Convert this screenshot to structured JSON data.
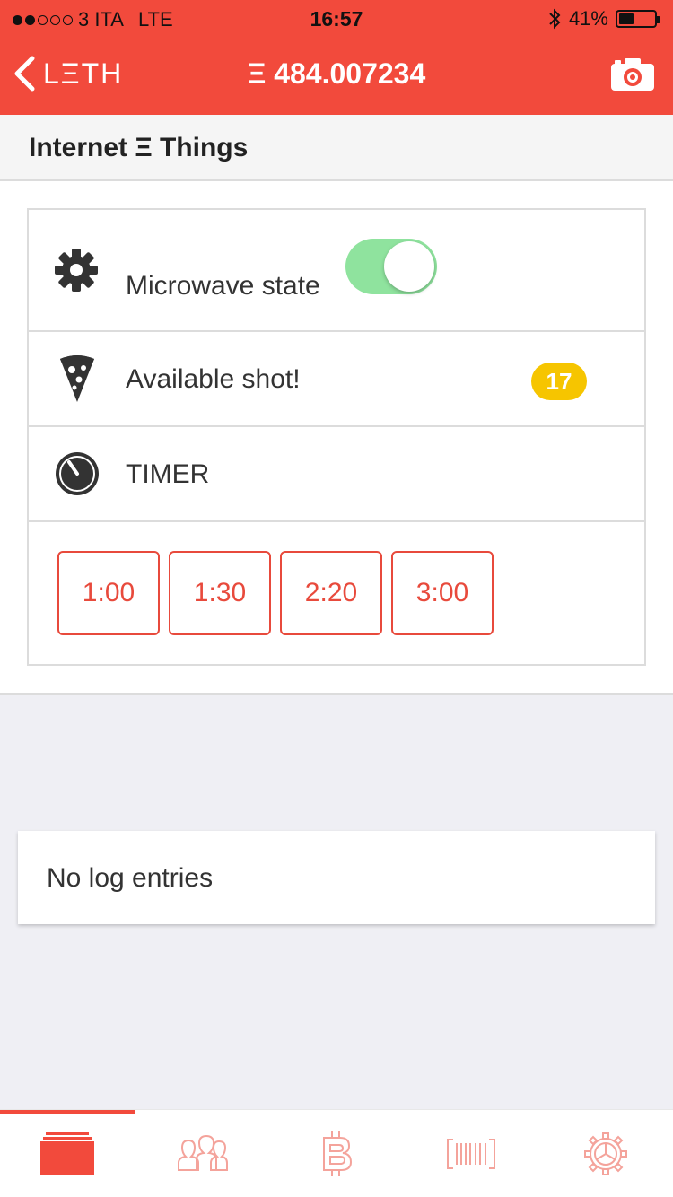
{
  "status_bar": {
    "carrier": "3 ITA",
    "network": "LTE",
    "time": "16:57",
    "battery": "41%",
    "battery_level": 0.41,
    "signal_bars_filled": 2,
    "signal_bars_total": 5
  },
  "nav": {
    "back_label": "LΞTH",
    "title": "Ξ 484.007234",
    "back_icon": "chevron-left-icon",
    "camera_icon": "camera-icon"
  },
  "section": {
    "title": "Internet Ξ Things"
  },
  "rows": {
    "microwave": {
      "label": "Microwave state",
      "icon": "gear-icon",
      "toggle_on": true
    },
    "shot": {
      "label": "Available shot!",
      "icon": "pizza-icon",
      "badge": "17"
    },
    "timer": {
      "label": "TIMER",
      "icon": "timer-icon"
    }
  },
  "timer_buttons": [
    "1:00",
    "1:30",
    "2:20",
    "3:00"
  ],
  "log": {
    "empty_text": "No log entries"
  },
  "tabs": [
    {
      "name": "dashboard",
      "icon": "cards-icon",
      "active": true
    },
    {
      "name": "contacts",
      "icon": "people-icon",
      "active": false
    },
    {
      "name": "bitcoin",
      "icon": "bitcoin-icon",
      "active": false
    },
    {
      "name": "barcode",
      "icon": "barcode-icon",
      "active": false
    },
    {
      "name": "settings",
      "icon": "gear-icon",
      "active": false
    }
  ],
  "colors": {
    "accent": "#f24a3c",
    "toggle_on": "#8fe39e",
    "badge": "#f6c500",
    "tab_inactive": "#f4a39b"
  }
}
